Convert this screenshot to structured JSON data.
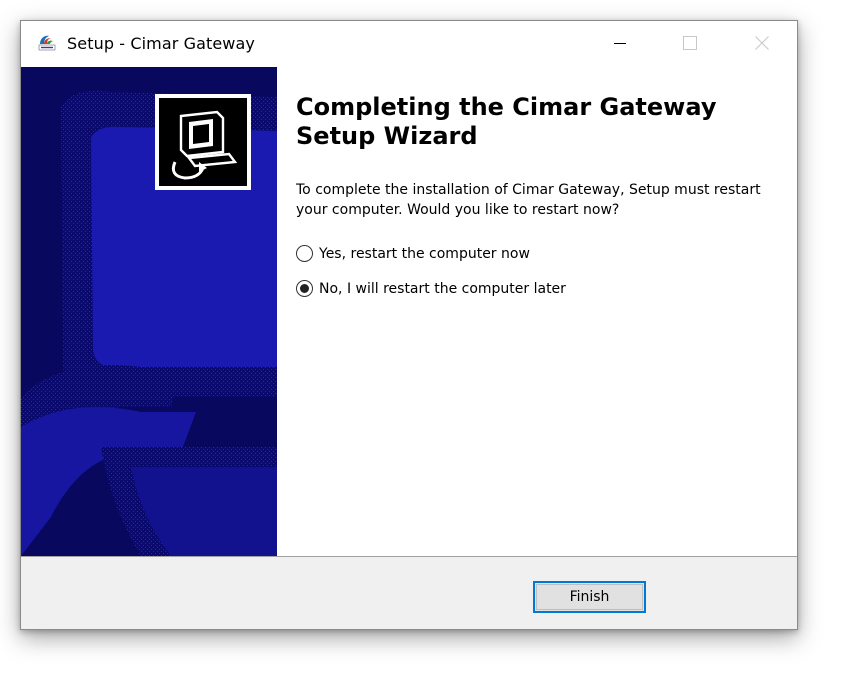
{
  "window": {
    "title": "Setup - Cimar Gateway",
    "app_icon_name": "cimar-app-icon",
    "controls": {
      "minimize_icon": "minimize-icon",
      "maximize_icon": "maximize-icon",
      "close_icon": "close-icon"
    }
  },
  "sidepanel": {
    "background_color": "#0a0a6e",
    "wizard_icon_name": "computer-setup-icon"
  },
  "content": {
    "heading": "Completing the Cimar Gateway Setup Wizard",
    "message": "To complete the installation of Cimar Gateway, Setup must restart your computer. Would you like to restart now?",
    "options": [
      {
        "label": "Yes, restart the computer now",
        "checked": false
      },
      {
        "label": "No, I will restart the computer later",
        "checked": true
      }
    ]
  },
  "footer": {
    "finish_label": "Finish",
    "accent_color": "#0078d7"
  }
}
